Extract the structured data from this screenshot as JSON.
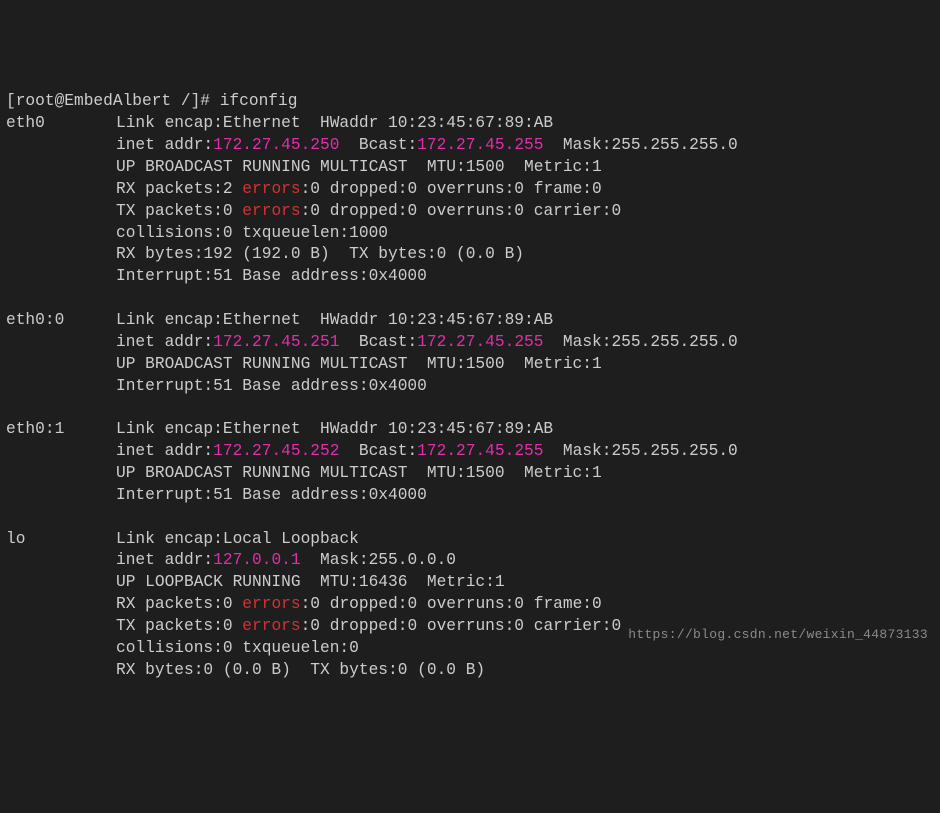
{
  "prompt": "[root@EmbedAlbert /]# ifconfig",
  "watermark": "https://blog.csdn.net/weixin_44873133",
  "interfaces": [
    {
      "name": "eth0",
      "lines": [
        {
          "segs": [
            {
              "t": "Link encap:Ethernet  HWaddr 10:23:45:67:89:AB  "
            }
          ]
        },
        {
          "segs": [
            {
              "t": "inet addr:"
            },
            {
              "t": "172.27.45.250",
              "cls": "magenta"
            },
            {
              "t": "  Bcast:"
            },
            {
              "t": "172.27.45.255",
              "cls": "magenta"
            },
            {
              "t": "  Mask:255.255.255.0"
            }
          ]
        },
        {
          "segs": [
            {
              "t": "UP BROADCAST RUNNING MULTICAST  MTU:1500  Metric:1"
            }
          ]
        },
        {
          "segs": [
            {
              "t": "RX packets:2 "
            },
            {
              "t": "errors",
              "cls": "red"
            },
            {
              "t": ":0 dropped:0 overruns:0 frame:0"
            }
          ]
        },
        {
          "segs": [
            {
              "t": "TX packets:0 "
            },
            {
              "t": "errors",
              "cls": "red"
            },
            {
              "t": ":0 dropped:0 overruns:0 carrier:0"
            }
          ]
        },
        {
          "segs": [
            {
              "t": "collisions:0 txqueuelen:1000 "
            }
          ]
        },
        {
          "segs": [
            {
              "t": "RX bytes:192 (192.0 B)  TX bytes:0 (0.0 B)"
            }
          ]
        },
        {
          "segs": [
            {
              "t": "Interrupt:51 Base address:0x4000"
            }
          ]
        }
      ]
    },
    {
      "name": "eth0:0",
      "lines": [
        {
          "segs": [
            {
              "t": "Link encap:Ethernet  HWaddr 10:23:45:67:89:AB  "
            }
          ]
        },
        {
          "segs": [
            {
              "t": "inet addr:"
            },
            {
              "t": "172.27.45.251",
              "cls": "magenta"
            },
            {
              "t": "  Bcast:"
            },
            {
              "t": "172.27.45.255",
              "cls": "magenta"
            },
            {
              "t": "  Mask:255.255.255.0"
            }
          ]
        },
        {
          "segs": [
            {
              "t": "UP BROADCAST RUNNING MULTICAST  MTU:1500  Metric:1"
            }
          ]
        },
        {
          "segs": [
            {
              "t": "Interrupt:51 Base address:0x4000"
            }
          ]
        }
      ]
    },
    {
      "name": "eth0:1",
      "lines": [
        {
          "segs": [
            {
              "t": "Link encap:Ethernet  HWaddr 10:23:45:67:89:AB  "
            }
          ]
        },
        {
          "segs": [
            {
              "t": "inet addr:"
            },
            {
              "t": "172.27.45.252",
              "cls": "magenta"
            },
            {
              "t": "  Bcast:"
            },
            {
              "t": "172.27.45.255",
              "cls": "magenta"
            },
            {
              "t": "  Mask:255.255.255.0"
            }
          ]
        },
        {
          "segs": [
            {
              "t": "UP BROADCAST RUNNING MULTICAST  MTU:1500  Metric:1"
            }
          ]
        },
        {
          "segs": [
            {
              "t": "Interrupt:51 Base address:0x4000"
            }
          ]
        }
      ]
    },
    {
      "name": "lo",
      "lines": [
        {
          "segs": [
            {
              "t": "Link encap:Local Loopback  "
            }
          ]
        },
        {
          "segs": [
            {
              "t": "inet addr:"
            },
            {
              "t": "127.0.0.1",
              "cls": "magenta"
            },
            {
              "t": "  Mask:255.0.0.0"
            }
          ]
        },
        {
          "segs": [
            {
              "t": "UP LOOPBACK RUNNING  MTU:16436  Metric:1"
            }
          ]
        },
        {
          "segs": [
            {
              "t": "RX packets:0 "
            },
            {
              "t": "errors",
              "cls": "red"
            },
            {
              "t": ":0 dropped:0 overruns:0 frame:0"
            }
          ]
        },
        {
          "segs": [
            {
              "t": "TX packets:0 "
            },
            {
              "t": "errors",
              "cls": "red"
            },
            {
              "t": ":0 dropped:0 overruns:0 carrier:0"
            }
          ]
        },
        {
          "segs": [
            {
              "t": "collisions:0 txqueuelen:0 "
            }
          ]
        },
        {
          "segs": [
            {
              "t": "RX bytes:0 (0.0 B)  TX bytes:0 (0.0 B)"
            }
          ]
        }
      ]
    }
  ]
}
